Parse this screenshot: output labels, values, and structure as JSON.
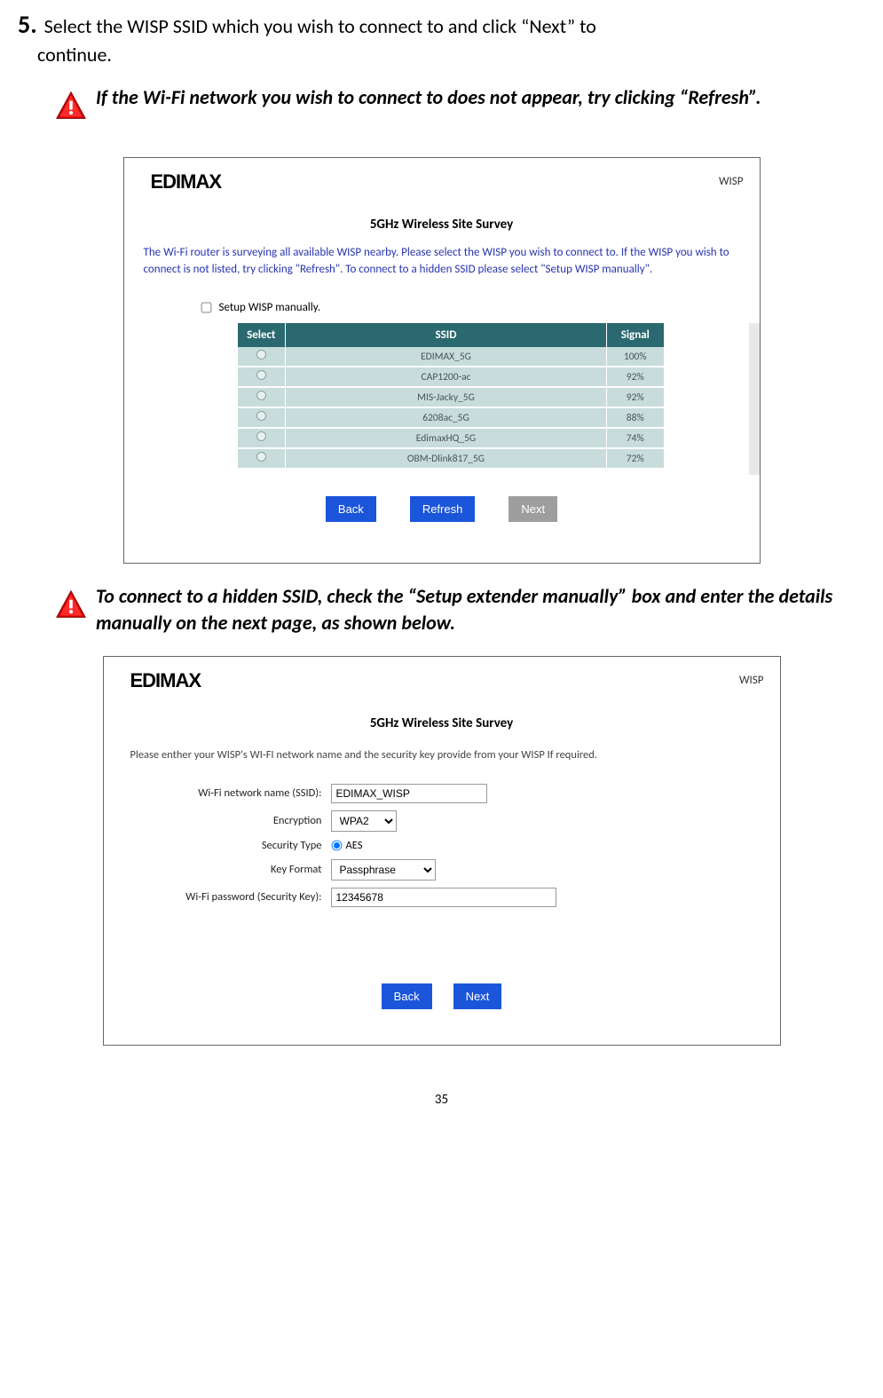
{
  "step": {
    "number": "5.",
    "text_a": "Select the WISP SSID which you wish to connect to and click “Next” to",
    "text_b": "continue."
  },
  "note1": "If the Wi-Fi network you wish to connect to does not appear, try clicking “Refresh”.",
  "note2": "To connect to a hidden SSID, check the “Setup extender manually” box and enter the details manually on the next page, as shown below.",
  "panel1": {
    "brand": "EDIMAX",
    "mode": "WISP",
    "title": "5GHz Wireless Site Survey",
    "desc": "The Wi-Fi router is surveying all available WISP nearby. Please select the WISP you wish to connect to. If the WISP you wish to connect is not listed, try clicking \"Refresh\". To connect to a hidden SSID please select \"Setup WISP manually\".",
    "manual_label": "Setup WISP manually.",
    "headers": {
      "select": "Select",
      "ssid": "SSID",
      "signal": "Signal"
    },
    "rows": [
      {
        "ssid": "EDIMAX_5G",
        "signal": "100%"
      },
      {
        "ssid": "CAP1200-ac",
        "signal": "92%"
      },
      {
        "ssid": "MIS-Jacky_5G",
        "signal": "92%"
      },
      {
        "ssid": "6208ac_5G",
        "signal": "88%"
      },
      {
        "ssid": "EdimaxHQ_5G",
        "signal": "74%"
      },
      {
        "ssid": "OBM-Dlink817_5G",
        "signal": "72%"
      }
    ],
    "buttons": {
      "back": "Back",
      "refresh": "Refresh",
      "next": "Next"
    }
  },
  "panel2": {
    "brand": "EDIMAX",
    "mode": "WISP",
    "title": "5GHz  Wireless Site Survey",
    "desc": "Please enther your WISP's WI-FI network name and the security key provide from your WISP If required.",
    "labels": {
      "ssid": "Wi-Fi network name (SSID):",
      "enc": "Encryption",
      "sec": "Security Type",
      "fmt": "Key Format",
      "pwd": "Wi-Fi password (Security Key):"
    },
    "values": {
      "ssid": "EDIMAX_WISP",
      "enc": "WPA2",
      "sec": "AES",
      "fmt": "Passphrase",
      "pwd": "12345678"
    },
    "buttons": {
      "back": "Back",
      "next": "Next"
    }
  },
  "page_number": "35"
}
